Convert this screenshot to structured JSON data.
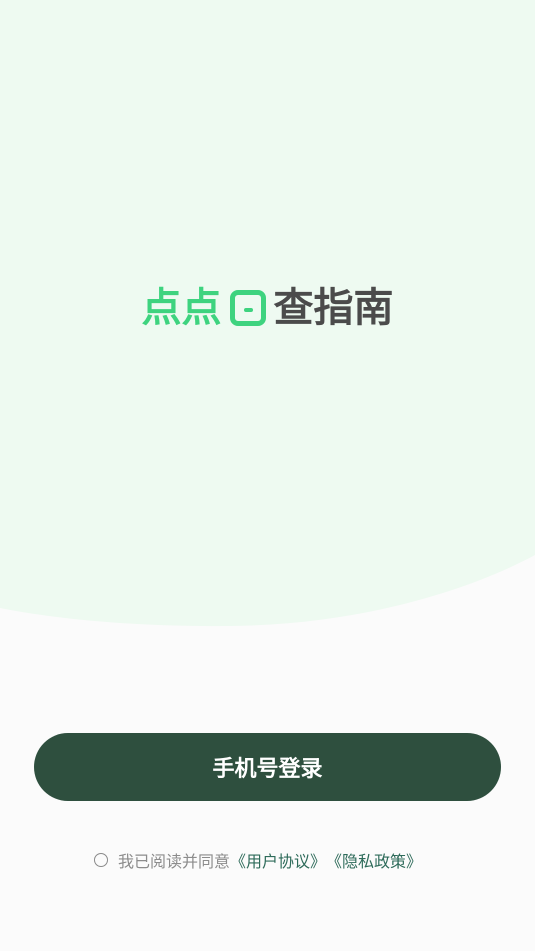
{
  "colors": {
    "background": "#fbfbfb",
    "hero_bg": "#eefaf1",
    "logo_green": "#3ed37f",
    "logo_dark": "#4b4b4b",
    "button_bg": "#2e4f3e",
    "link": "#2e6b5a"
  },
  "logo": {
    "part1": "点点",
    "part2": "查指南",
    "box_icon": "minus-box-icon"
  },
  "login_button": {
    "label": "手机号登录"
  },
  "agreement": {
    "checked": false,
    "text": "我已阅读并同意",
    "user_agreement": "《用户协议》",
    "privacy_policy": "《隐私政策》"
  }
}
